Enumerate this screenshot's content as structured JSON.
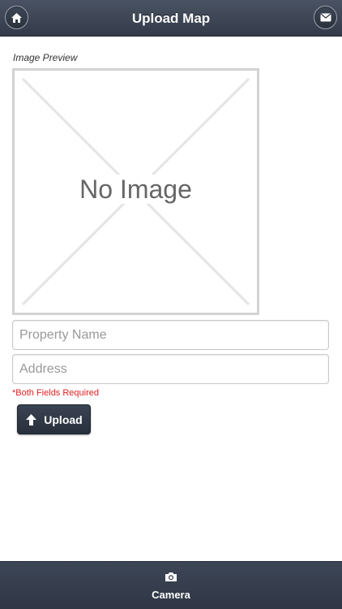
{
  "header": {
    "title": "Upload Map",
    "home_icon": "home-icon",
    "mail_icon": "mail-icon"
  },
  "preview": {
    "label": "Image Preview",
    "placeholder_text": "No Image"
  },
  "form": {
    "property_name_placeholder": "Property Name",
    "property_name_value": "",
    "address_placeholder": "Address",
    "address_value": "",
    "required_note": "*Both Fields Required"
  },
  "upload_button": {
    "label": "Upload",
    "icon": "upload-arrow-icon"
  },
  "footer": {
    "tab_label": "Camera",
    "tab_icon": "camera-icon"
  },
  "colors": {
    "header_bg": "#3a4250",
    "button_bg": "#2f3744",
    "required_text": "#e02020",
    "border": "#d3d3d3"
  }
}
